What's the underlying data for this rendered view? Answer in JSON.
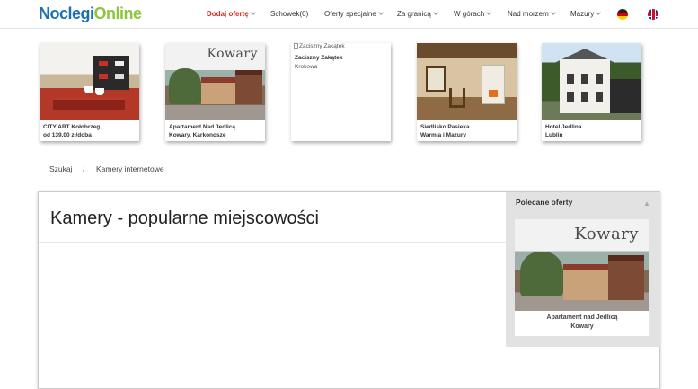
{
  "header": {
    "logo_part1": "Noclegi",
    "logo_part2": "Online",
    "nav": [
      {
        "label": "Dodaj ofertę",
        "accent": true,
        "dropdown": true
      },
      {
        "label": "Schowek(0)",
        "accent": false,
        "dropdown": false
      },
      {
        "label": "Oferty specjalne",
        "accent": false,
        "dropdown": true
      },
      {
        "label": "Za granicą",
        "accent": false,
        "dropdown": true
      },
      {
        "label": "W górach",
        "accent": false,
        "dropdown": true
      },
      {
        "label": "Nad morzem",
        "accent": false,
        "dropdown": true
      },
      {
        "label": "Mazury",
        "accent": false,
        "dropdown": true
      }
    ],
    "languages": [
      "de-flag-icon",
      "gb-flag-icon"
    ]
  },
  "cards": [
    {
      "line1": "CITY ART Kołobrzeg",
      "line2": "od 139.00 zł/doba"
    },
    {
      "line1": "Apartament Nad Jedlicą",
      "line2": "Kowary, Karkonosze",
      "image_text": "Kowary"
    },
    {
      "image_alt": "Zaciszny Zakątek",
      "line1": "Zaciszny Zakątek",
      "line2": "Krokowa"
    },
    {
      "line1": "Siedlisko Pasieka",
      "line2": "Warmia i Mazury"
    },
    {
      "line1": "Hotel Jedlina",
      "line2": "Lublin"
    }
  ],
  "breadcrumb": {
    "items": [
      "Szukaj",
      "Kamery internetowe"
    ],
    "separator": "/"
  },
  "main": {
    "title": "Kamery - popularne miejscowości"
  },
  "sidebar": {
    "title": "Polecane oferty",
    "collapse_glyph": "▲",
    "offer": {
      "image_text": "Kowary",
      "line1": "Apartament nad Jedlicą",
      "line2": "Kowary"
    }
  },
  "colors": {
    "logo_blue": "#1a6fb5",
    "logo_green": "#8cc63e",
    "accent_red": "#e2231a",
    "sidebar_bg": "#e2e2e2"
  }
}
